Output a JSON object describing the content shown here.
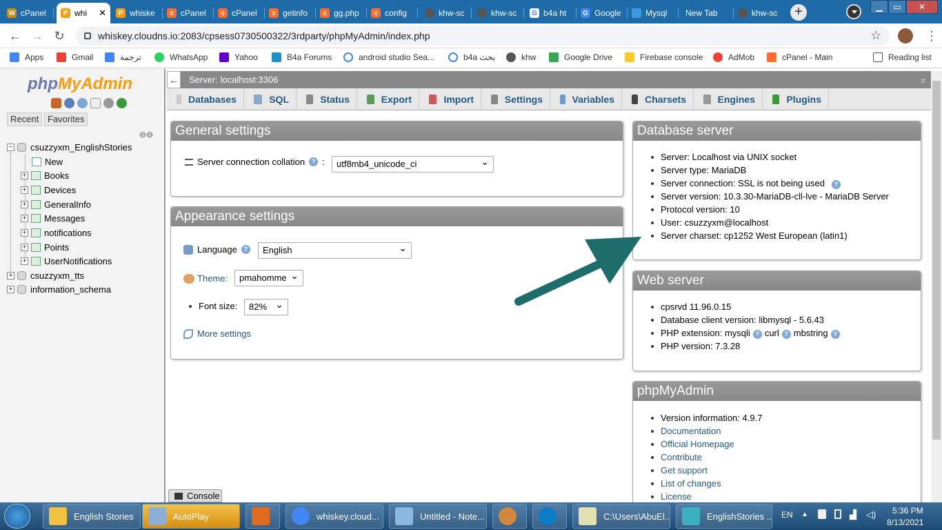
{
  "browser": {
    "tabs": [
      {
        "title": "cPanel",
        "color": "#cc8a0e"
      },
      {
        "title": "whi",
        "color": "#f89c0e",
        "active": true
      },
      {
        "title": "whiske",
        "color": "#f89c0e"
      },
      {
        "title": "cPanel",
        "color": "#ff6c2c"
      },
      {
        "title": "cPanel",
        "color": "#ff6c2c"
      },
      {
        "title": "getinfo",
        "color": "#ff6c2c"
      },
      {
        "title": "gg.php",
        "color": "#ff6c2c"
      },
      {
        "title": "config",
        "color": "#ff6c2c"
      },
      {
        "title": "khw-sc",
        "color": "#555555"
      },
      {
        "title": "khw-sc",
        "color": "#555555"
      },
      {
        "title": "b4a ht",
        "color": "#4285f4"
      },
      {
        "title": "Google",
        "color": "#4285f4"
      },
      {
        "title": "Mysql",
        "color": "#3c9ae0"
      },
      {
        "title": "New Tab",
        "color": ""
      },
      {
        "title": "khw-sc",
        "color": "#555555"
      }
    ],
    "url": "whiskey.cloudns.io:2083/cpsess0730500322/3rdparty/phpMyAdmin/index.php",
    "bookmarks": [
      {
        "label": "Apps",
        "color": "#4285f4"
      },
      {
        "label": "Gmail",
        "color": "#ea4335"
      },
      {
        "label": "ترجمة",
        "color": "#4285f4"
      },
      {
        "label": "WhatsApp",
        "color": "#25d366"
      },
      {
        "label": "Yahoo",
        "color": "#6001d2"
      },
      {
        "label": "B4a Forums",
        "color": "#1e90c8"
      },
      {
        "label": "android studio Sea...",
        "color": "#4285f4"
      },
      {
        "label": "b4a بحث",
        "color": "#4285f4"
      },
      {
        "label": "khw",
        "color": "#555555"
      },
      {
        "label": "Google Drive",
        "color": "#34a853"
      },
      {
        "label": "Firebase console",
        "color": "#ffca28"
      },
      {
        "label": "AdMob",
        "color": "#ea4335"
      },
      {
        "label": "cPanel - Main",
        "color": "#ff6c2c"
      },
      {
        "label": "Reading list",
        "color": "#555555"
      }
    ]
  },
  "pma": {
    "logo_php": "php",
    "logo_myadmin": "MyAdmin",
    "recent": "Recent",
    "favorites": "Favorites",
    "tree": {
      "db1": "csuzzyxm_EnglishStories",
      "new": "New",
      "tables": [
        "Books",
        "Devices",
        "GeneralInfo",
        "Messages",
        "notifications",
        "Points",
        "UserNotifications"
      ],
      "db2": "csuzzyxm_tts",
      "db3": "information_schema"
    },
    "server_title": "Server: localhost:3306",
    "menu": [
      {
        "label": "Databases",
        "color": "#cccccc"
      },
      {
        "label": "SQL",
        "color": "#8aa8c8"
      },
      {
        "label": "Status",
        "color": "#888888"
      },
      {
        "label": "Export",
        "color": "#5a9a5a"
      },
      {
        "label": "Import",
        "color": "#c85a5a"
      },
      {
        "label": "Settings",
        "color": "#888888"
      },
      {
        "label": "Variables",
        "color": "#6a9ad0"
      },
      {
        "label": "Charsets",
        "color": "#444444"
      },
      {
        "label": "Engines",
        "color": "#999999"
      },
      {
        "label": "Plugins",
        "color": "#3a9a3a"
      }
    ],
    "general": {
      "title": "General settings",
      "collation_label": "Server connection collation",
      "collation_value": "utf8mb4_unicode_ci"
    },
    "appearance": {
      "title": "Appearance settings",
      "language_label": "Language",
      "language_value": "English",
      "theme_label": "Theme:",
      "theme_value": "pmahomme",
      "fontsize_label": "Font size:",
      "fontsize_value": "82%",
      "more": "More settings"
    },
    "dbserver": {
      "title": "Database server",
      "items": [
        "Server: Localhost via UNIX socket",
        "Server type: MariaDB",
        "Server connection: SSL is not being used",
        "Server version: 10.3.30-MariaDB-cll-lve - MariaDB Server",
        "Protocol version: 10",
        "User: csuzzyxm@localhost",
        "Server charset: cp1252 West European (latin1)"
      ]
    },
    "webserver": {
      "title": "Web server",
      "items": [
        "cpsrvd 11.96.0.15",
        "Database client version: libmysql - 5.6.43",
        "PHP extension: mysqli",
        "PHP version: 7.3.28"
      ],
      "ext_curl": "curl",
      "ext_mbstring": "mbstring"
    },
    "pmainfo": {
      "title": "phpMyAdmin",
      "version": "Version information: 4.9.7",
      "links": [
        "Documentation",
        "Official Homepage",
        "Contribute",
        "Get support",
        "List of changes",
        "License"
      ]
    },
    "console": "Console"
  },
  "taskbar": {
    "items": [
      {
        "label": "English Stories",
        "color": "#f0c040"
      },
      {
        "label": "AutoPlay",
        "color": "#8ab0d8"
      },
      {
        "label": "",
        "color": "#e06a20"
      },
      {
        "label": "whiskey.cloud...",
        "color": "#4285f4"
      },
      {
        "label": "Untitled - Note...",
        "color": "#8ab8e0"
      },
      {
        "label": "",
        "color": "#d08840"
      },
      {
        "label": "",
        "color": "#0a7cc8"
      },
      {
        "label": "C:\\Users\\AbuEl...",
        "color": "#e0e0b0"
      },
      {
        "label": "EnglishStories ...",
        "color": "#3ab0c0"
      }
    ],
    "lang": "EN",
    "time": "5:36 PM",
    "date": "8/13/2021"
  }
}
